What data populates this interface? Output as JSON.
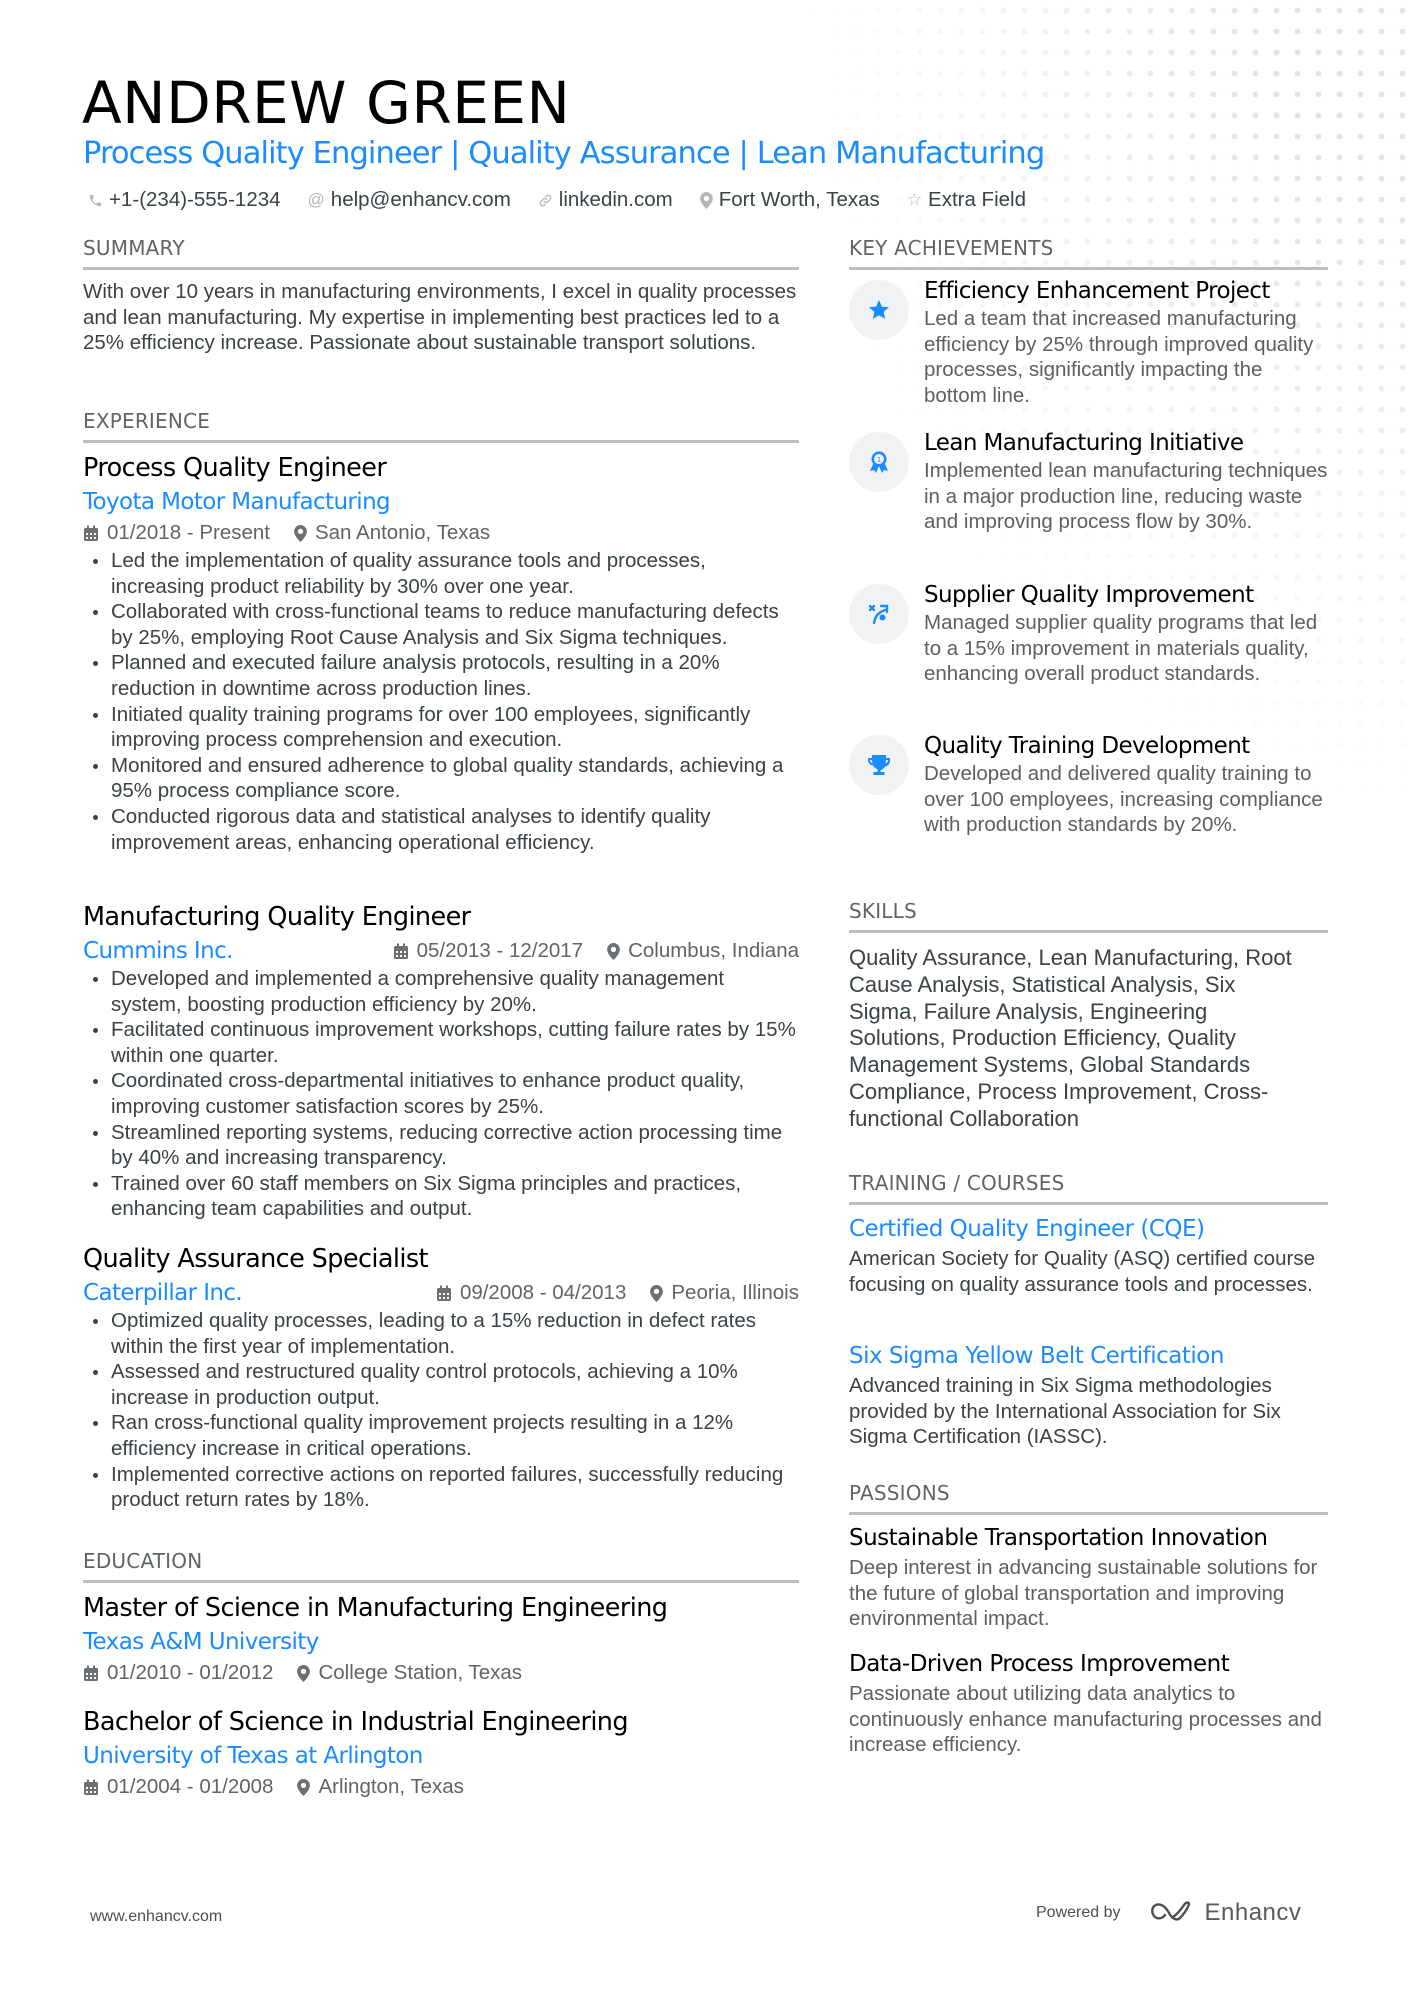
{
  "header": {
    "name": "ANDREW GREEN",
    "title": "Process Quality Engineer | Quality Assurance | Lean Manufacturing",
    "contacts": [
      {
        "icon": "phone-icon",
        "text": "+1-(234)-555-1234"
      },
      {
        "icon": "at-icon",
        "text": "help@enhancv.com"
      },
      {
        "icon": "link-icon",
        "text": "linkedin.com"
      },
      {
        "icon": "location-pin-icon",
        "text": "Fort Worth, Texas"
      },
      {
        "icon": "star-outline-icon",
        "text": "Extra Field"
      }
    ]
  },
  "summary": {
    "heading": "SUMMARY",
    "text": "With over 10 years in manufacturing environments, I excel in quality processes and lean manufacturing. My expertise in implementing best practices led to a 25% efficiency increase. Passionate about sustainable transport solutions."
  },
  "experience": {
    "heading": "EXPERIENCE",
    "jobs": [
      {
        "title": "Process Quality Engineer",
        "company": "Toyota Motor Manufacturing",
        "dates": "01/2018 - Present",
        "location": "San Antonio, Texas",
        "bullets": [
          "Led the implementation of quality assurance tools and processes, increasing product reliability by 30% over one year.",
          "Collaborated with cross-functional teams to reduce manufacturing defects by 25%, employing Root Cause Analysis and Six Sigma techniques.",
          "Planned and executed failure analysis protocols, resulting in a 20% reduction in downtime across production lines.",
          "Initiated quality training programs for over 100 employees, significantly improving process comprehension and execution.",
          "Monitored and ensured adherence to global quality standards, achieving a 95% process compliance score.",
          "Conducted rigorous data and statistical analyses to identify quality improvement areas, enhancing operational efficiency."
        ]
      },
      {
        "title": "Manufacturing Quality Engineer",
        "company": "Cummins Inc.",
        "dates": "05/2013 - 12/2017",
        "location": "Columbus, Indiana",
        "bullets": [
          "Developed and implemented a comprehensive quality management system, boosting production efficiency by 20%.",
          "Facilitated continuous improvement workshops, cutting failure rates by 15% within one quarter.",
          "Coordinated cross-departmental initiatives to enhance product quality, improving customer satisfaction scores by 25%.",
          "Streamlined reporting systems, reducing corrective action processing time by 40% and increasing transparency.",
          "Trained over 60 staff members on Six Sigma principles and practices, enhancing team capabilities and output."
        ]
      },
      {
        "title": "Quality Assurance Specialist",
        "company": "Caterpillar Inc.",
        "dates": "09/2008 - 04/2013",
        "location": "Peoria, Illinois",
        "bullets": [
          "Optimized quality processes, leading to a 15% reduction in defect rates within the first year of implementation.",
          "Assessed and restructured quality control protocols, achieving a 10% increase in production output.",
          "Ran cross-functional quality improvement projects resulting in a 12% efficiency increase in critical operations.",
          "Implemented corrective actions on reported failures, successfully reducing product return rates by 18%."
        ]
      }
    ]
  },
  "education": {
    "heading": "EDUCATION",
    "items": [
      {
        "degree": "Master of Science in Manufacturing Engineering",
        "school": "Texas A&M University",
        "dates": "01/2010 - 01/2012",
        "location": "College Station, Texas"
      },
      {
        "degree": "Bachelor of Science in Industrial Engineering",
        "school": "University of Texas at Arlington",
        "dates": "01/2004 - 01/2008",
        "location": "Arlington, Texas"
      }
    ]
  },
  "achievements": {
    "heading": "KEY ACHIEVEMENTS",
    "icon_color": "#1a8cff",
    "items": [
      {
        "icon": "star-icon",
        "title": "Efficiency Enhancement Project",
        "desc": "Led a team that increased manufacturing efficiency by 25% through improved quality processes, significantly impacting the bottom line."
      },
      {
        "icon": "award-ribbon-icon",
        "title": "Lean Manufacturing Initiative",
        "desc": "Implemented lean manufacturing techniques in a major production line, reducing waste and improving process flow by 30%."
      },
      {
        "icon": "strategy-arrow-icon",
        "title": "Supplier Quality Improvement",
        "desc": "Managed supplier quality programs that led to a 15% improvement in materials quality, enhancing overall product standards."
      },
      {
        "icon": "trophy-icon",
        "title": "Quality Training Development",
        "desc": "Developed and delivered quality training to over 100 employees, increasing compliance with production standards by 20%."
      }
    ]
  },
  "skills": {
    "heading": "SKILLS",
    "text": "Quality Assurance, Lean Manufacturing, Root Cause Analysis, Statistical Analysis, Six Sigma, Failure Analysis, Engineering Solutions, Production Efficiency, Quality Management Systems, Global Standards Compliance, Process Improvement, Cross-functional Collaboration"
  },
  "training": {
    "heading": "TRAINING / COURSES",
    "items": [
      {
        "title": "Certified Quality Engineer (CQE)",
        "desc": "American Society for Quality (ASQ) certified course focusing on quality assurance tools and processes."
      },
      {
        "title": "Six Sigma Yellow Belt Certification",
        "desc": "Advanced training in Six Sigma methodologies provided by the International Association for Six Sigma Certification (IASSC)."
      }
    ]
  },
  "passions": {
    "heading": "PASSIONS",
    "items": [
      {
        "title": "Sustainable Transportation Innovation",
        "desc": "Deep interest in advancing sustainable solutions for the future of global transportation and improving environmental impact."
      },
      {
        "title": "Data-Driven Process Improvement",
        "desc": "Passionate about utilizing data analytics to continuously enhance manufacturing processes and increase efficiency."
      }
    ]
  },
  "footer": {
    "website": "www.enhancv.com",
    "powered_by": "Powered by",
    "brand": "Enhancv"
  },
  "colors": {
    "accent": "#1a8cff",
    "heading_gray": "#5f6468",
    "body_text": "#384347",
    "divider": "#bcbfc2"
  }
}
